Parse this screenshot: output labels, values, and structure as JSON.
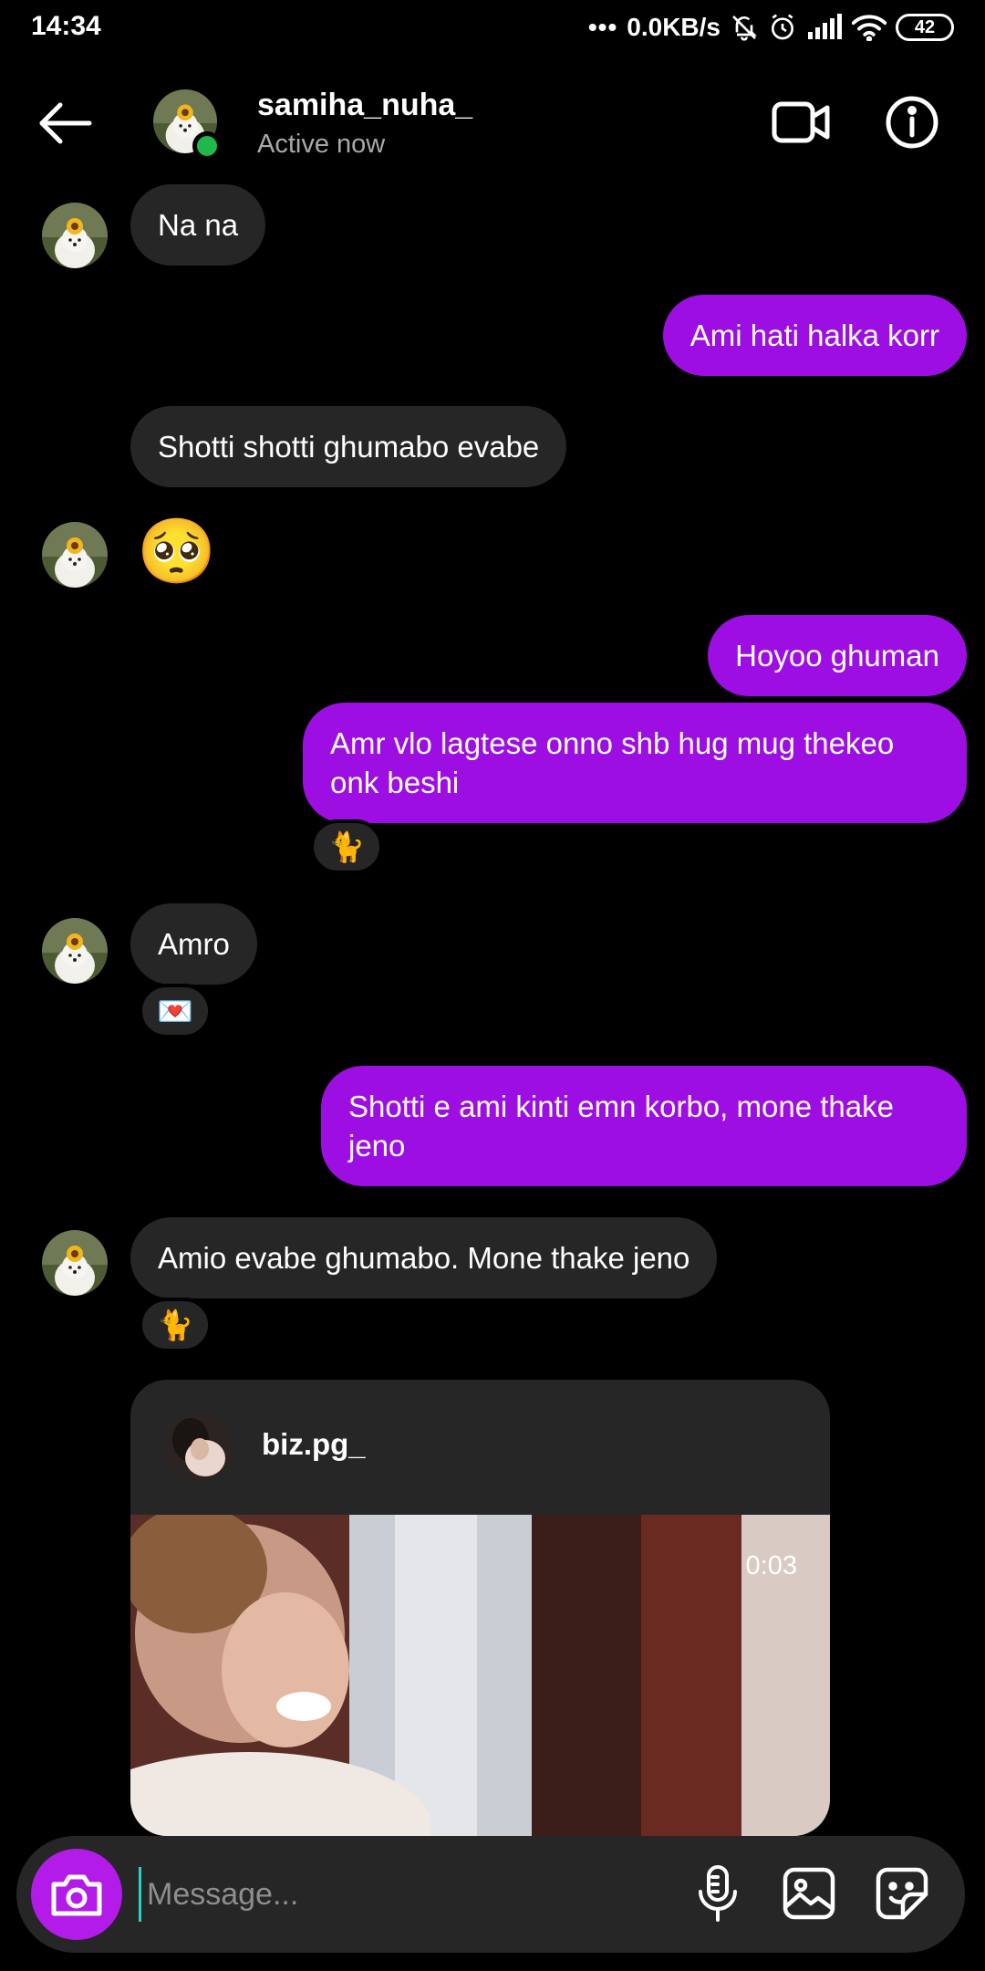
{
  "status_bar": {
    "time": "14:34",
    "dots": "•••",
    "net_speed": "0.0KB/s",
    "battery": "42"
  },
  "header": {
    "username": "samiha_nuha_",
    "status": "Active now",
    "online_color": "#1fb84a"
  },
  "messages": [
    {
      "from": "them",
      "text": "Na na"
    },
    {
      "from": "me",
      "text": "Ami hati halka korr"
    },
    {
      "from": "them",
      "text": "Shotti shotti ghumabo evabe"
    },
    {
      "from": "them",
      "emoji": "🥺"
    },
    {
      "from": "me",
      "text": "Hoyoo ghuman"
    },
    {
      "from": "me",
      "text": "Amr vlo lagtese onno shb hug mug thekeo\nonk beshi",
      "reaction": "🐈"
    },
    {
      "from": "them",
      "text": "Amro",
      "reaction": "💌"
    },
    {
      "from": "me",
      "text": "Shotti e ami kinti emn korbo, mone thake\njeno"
    },
    {
      "from": "them",
      "text": "Amio evabe ghumabo. Mone thake jeno",
      "reaction": "🐈"
    }
  ],
  "shared_post": {
    "username": "biz.pg_",
    "duration": "0:03"
  },
  "composer": {
    "placeholder": "Message..."
  },
  "colors": {
    "outgoing_bubble": "#9d0ee2",
    "incoming_bubble": "#262626",
    "camera_button": "#b21be8",
    "background": "#000000"
  },
  "icons": [
    "back-arrow-icon",
    "video-call-icon",
    "info-icon",
    "camera-icon",
    "microphone-icon",
    "gallery-icon",
    "sticker-icon",
    "wifi-icon",
    "signal-icon",
    "alarm-icon",
    "mute-icon"
  ]
}
